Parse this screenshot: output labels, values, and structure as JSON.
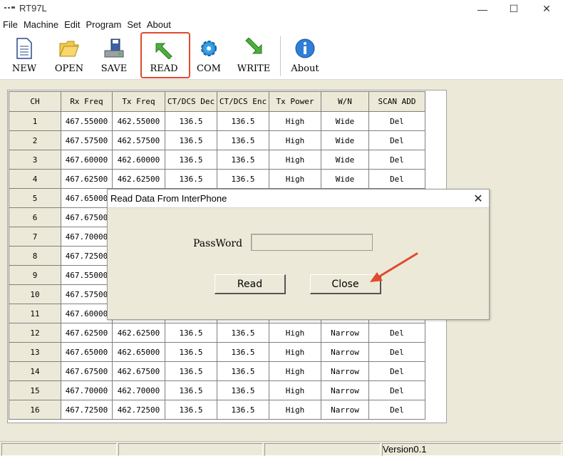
{
  "window": {
    "title": "RT97L",
    "min_glyph": "—",
    "max_glyph": "☐",
    "close_glyph": "✕"
  },
  "menu": [
    "File",
    "Machine",
    "Edit",
    "Program",
    "Set",
    "About"
  ],
  "toolbar": {
    "new": "NEW",
    "open": "OPEN",
    "save": "SAVE",
    "read": "READ",
    "com": "COM",
    "write": "WRITE",
    "about": "About",
    "highlight_color": "#e04a2f"
  },
  "table": {
    "headers": [
      "CH",
      "Rx Freq",
      "Tx Freq",
      "CT/DCS Dec",
      "CT/DCS Enc",
      "Tx Power",
      "W/N",
      "SCAN ADD"
    ],
    "rows": [
      [
        "1",
        "467.55000",
        "462.55000",
        "136.5",
        "136.5",
        "High",
        "Wide",
        "Del"
      ],
      [
        "2",
        "467.57500",
        "462.57500",
        "136.5",
        "136.5",
        "High",
        "Wide",
        "Del"
      ],
      [
        "3",
        "467.60000",
        "462.60000",
        "136.5",
        "136.5",
        "High",
        "Wide",
        "Del"
      ],
      [
        "4",
        "467.62500",
        "462.62500",
        "136.5",
        "136.5",
        "High",
        "Wide",
        "Del"
      ],
      [
        "5",
        "467.65000",
        "",
        "",
        "",
        "",
        "",
        ""
      ],
      [
        "6",
        "467.67500",
        "",
        "",
        "",
        "",
        "",
        ""
      ],
      [
        "7",
        "467.70000",
        "",
        "",
        "",
        "",
        "",
        ""
      ],
      [
        "8",
        "467.72500",
        "",
        "",
        "",
        "",
        "",
        ""
      ],
      [
        "9",
        "467.55000",
        "",
        "",
        "",
        "",
        "",
        ""
      ],
      [
        "10",
        "467.57500",
        "",
        "",
        "",
        "",
        "",
        ""
      ],
      [
        "11",
        "467.60000",
        "",
        "",
        "",
        "",
        "",
        ""
      ],
      [
        "12",
        "467.62500",
        "462.62500",
        "136.5",
        "136.5",
        "High",
        "Narrow",
        "Del"
      ],
      [
        "13",
        "467.65000",
        "462.65000",
        "136.5",
        "136.5",
        "High",
        "Narrow",
        "Del"
      ],
      [
        "14",
        "467.67500",
        "462.67500",
        "136.5",
        "136.5",
        "High",
        "Narrow",
        "Del"
      ],
      [
        "15",
        "467.70000",
        "462.70000",
        "136.5",
        "136.5",
        "High",
        "Narrow",
        "Del"
      ],
      [
        "16",
        "467.72500",
        "462.72500",
        "136.5",
        "136.5",
        "High",
        "Narrow",
        "Del"
      ]
    ]
  },
  "dialog": {
    "title": "Read Data From InterPhone",
    "close_glyph": "✕",
    "password_label": "PassWord",
    "password_value": "",
    "read_button": "Read",
    "close_button": "Close"
  },
  "annotation": {
    "arrow_color": "#e04a2f"
  },
  "statusbar": {
    "version": "Version0.1"
  }
}
